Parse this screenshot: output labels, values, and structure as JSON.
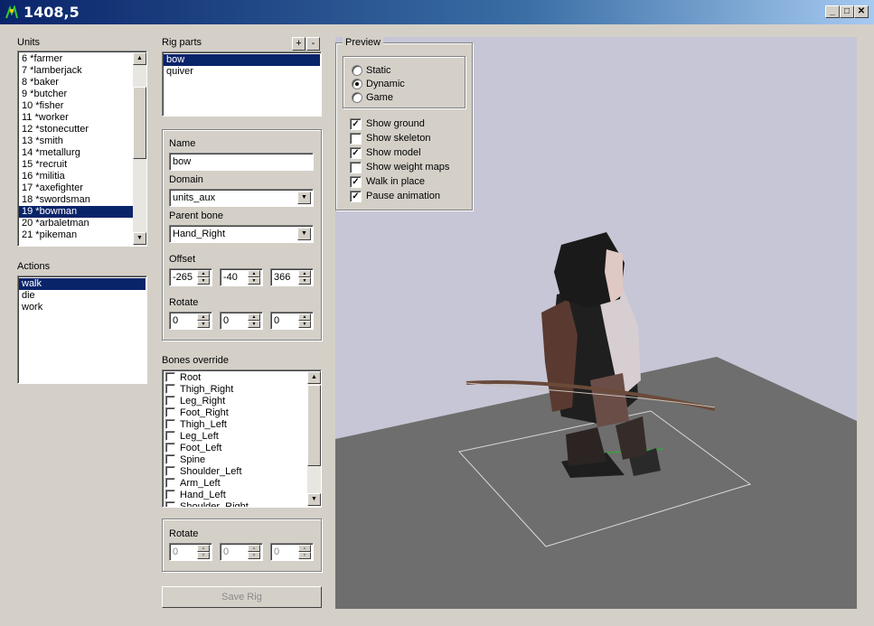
{
  "window": {
    "title": "1408,5"
  },
  "units": {
    "label": "Units",
    "items": [
      "6 *farmer",
      "7 *lamberjack",
      "8 *baker",
      "9 *butcher",
      "10 *fisher",
      "11 *worker",
      "12 *stonecutter",
      "13 *smith",
      "14 *metallurg",
      "15 *recruit",
      "16 *militia",
      "17 *axefighter",
      "18 *swordsman",
      "19 *bowman",
      "20 *arbaletman",
      "21 *pikeman"
    ],
    "selected_index": 13
  },
  "actions": {
    "label": "Actions",
    "items": [
      "walk",
      "die",
      "work"
    ],
    "selected_index": 0
  },
  "rig_parts": {
    "label": "Rig parts",
    "add_label": "+",
    "remove_label": "-",
    "items": [
      "bow",
      "quiver"
    ],
    "selected_index": 0
  },
  "part_props": {
    "name_label": "Name",
    "name_value": "bow",
    "domain_label": "Domain",
    "domain_value": "units_aux",
    "parent_label": "Parent bone",
    "parent_value": "Hand_Right",
    "offset_label": "Offset",
    "offset": [
      "-265",
      "-40",
      "366"
    ],
    "rotate_label": "Rotate",
    "rotate": [
      "0",
      "0",
      "0"
    ]
  },
  "bones_override": {
    "label": "Bones override",
    "items": [
      "Root",
      "Thigh_Right",
      "Leg_Right",
      "Foot_Right",
      "Thigh_Left",
      "Leg_Left",
      "Foot_Left",
      "Spine",
      "Shoulder_Left",
      "Arm_Left",
      "Hand_Left",
      "Shoulder_Right"
    ]
  },
  "bone_rotate": {
    "label": "Rotate",
    "values": [
      "0",
      "0",
      "0"
    ]
  },
  "save_button": "Save Rig",
  "preview": {
    "label": "Preview",
    "modes": [
      {
        "label": "Static",
        "checked": false
      },
      {
        "label": "Dynamic",
        "checked": true
      },
      {
        "label": "Game",
        "checked": false
      }
    ],
    "options": [
      {
        "label": "Show ground",
        "checked": true
      },
      {
        "label": "Show skeleton",
        "checked": false
      },
      {
        "label": "Show model",
        "checked": true
      },
      {
        "label": "Show weight maps",
        "checked": false
      },
      {
        "label": "Walk in place",
        "checked": true
      },
      {
        "label": "Pause animation",
        "checked": true
      }
    ]
  },
  "colors": {
    "titlebar": "#0a246a",
    "selection": "#0a246a",
    "viewport_bg": "#c6c6d6",
    "ground": "#6e6e6e"
  }
}
